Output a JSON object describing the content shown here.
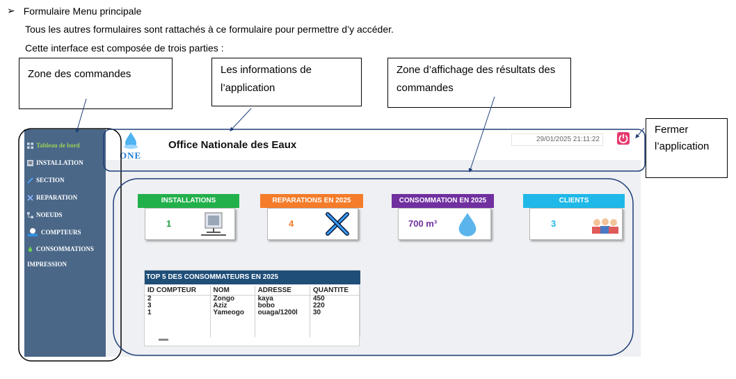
{
  "doc": {
    "bullet_symbol": "➢",
    "heading": "Formulaire Menu principale",
    "line1": "Tous les autres formulaires sont rattachés à ce formulaire pour permettre d’y accéder.",
    "line2": "Cette interface est composée de trois parties :"
  },
  "callouts": {
    "commands": "Zone des commandes",
    "app_info": "Les informations de l’application",
    "results": "Zone d’affichage des résultats des commandes",
    "close": "Fermer l’application"
  },
  "app": {
    "logo_text": "ONE",
    "title": "Office Nationale des Eaux",
    "datetime": "29/01/2025 21:11:22",
    "sidebar": [
      {
        "label": "Tableau de bord",
        "icon": "grid-icon"
      },
      {
        "label": "INSTALLATION",
        "icon": "installation-icon"
      },
      {
        "label": "SECTION",
        "icon": "section-icon"
      },
      {
        "label": "REPARATION",
        "icon": "tools-icon"
      },
      {
        "label": "NOEUDS",
        "icon": "nodes-icon"
      },
      {
        "label": "COMPTEURS",
        "icon": "meter-icon"
      },
      {
        "label": "CONSOMMATIONS",
        "icon": "consumption-icon"
      },
      {
        "label": "IMPRESSION",
        "icon": ""
      }
    ],
    "cards": [
      {
        "title": "INSTALLATIONS",
        "value": "1",
        "color": "#22b04b",
        "value_color": "#22a040",
        "icon": "installation-icon"
      },
      {
        "title": "REPARATIONS EN  2025",
        "value": "4",
        "color": "#f47c2a",
        "value_color": "#f47c2a",
        "icon": "tools-icon"
      },
      {
        "title": "CONSOMMATION EN  2025",
        "value": "700  m³",
        "color": "#7030a0",
        "value_color": "#7030a0",
        "icon": "water-drop-icon"
      },
      {
        "title": "CLIENTS",
        "value": "3",
        "color": "#1fb8e8",
        "value_color": "#1fb8e8",
        "icon": "clients-icon"
      }
    ],
    "top5": {
      "title": "TOP 5 DES CONSOMMATEURS EN     2025",
      "columns": [
        "ID COMPTEUR",
        "NOM",
        "ADRESSE",
        "QUANTITE"
      ],
      "rows": [
        [
          "2",
          "Zongo",
          "kaya",
          "450"
        ],
        [
          "3",
          "Aziz",
          "bobo",
          "220"
        ],
        [
          "1",
          "Yameogo",
          "ouaga/1200l",
          "30"
        ]
      ]
    },
    "colors": {
      "sidebar": "#4a6788",
      "sidebar_active": "#9ad15a",
      "power": "#e63b6f",
      "logo": "#1a7ad6",
      "table_header": "#1f4e79"
    }
  }
}
